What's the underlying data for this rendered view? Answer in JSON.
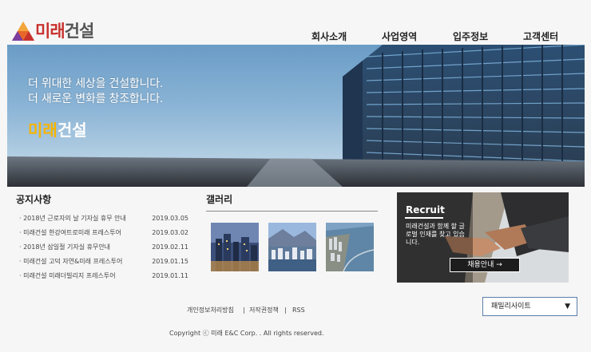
{
  "header": {
    "logo_text_1": "미래",
    "logo_text_2": "건설",
    "nav": [
      "회사소개",
      "사업영역",
      "입주정보",
      "고객센터"
    ]
  },
  "hero": {
    "line1": "더 위대한 세상을 건설합니다.",
    "line2": "더 새로운 변화를 창조합니다.",
    "brand_1": "미래",
    "brand_2": "건설"
  },
  "notice": {
    "title": "공지사항",
    "items": [
      {
        "title": "· 2018년 근로자의 날 기자실 휴무 안내",
        "date": "2019.03.05"
      },
      {
        "title": "· 미래건설 한강여트로미래 프레스투어",
        "date": "2019.03.02"
      },
      {
        "title": "· 2018년 삼일절 기자실 휴무안내",
        "date": "2019.02.11"
      },
      {
        "title": "· 미래건설 고덕 자연&미래 프레스투어",
        "date": "2019.01.15"
      },
      {
        "title": "· 미래건설 미래더빌리지 프레스투어",
        "date": "2019.01.11"
      }
    ]
  },
  "gallery": {
    "title": "갤러리"
  },
  "recruit": {
    "title": "Recruit",
    "desc": "미래건설과 함께 할 글로벌 인재를 찾고 있습니다.",
    "button": "채용안내  →"
  },
  "family_site": {
    "value": "패밀리사이트",
    "arrow": "▼"
  },
  "footer": {
    "links": [
      "개인정보처리방침",
      "|",
      "저작권정책",
      "|",
      "RSS"
    ],
    "copyright": "Copyright ⓒ 미래 E&C Corp. . All rights reserved."
  },
  "colors": {
    "brand_red": "#c8322d",
    "brand_gold": "#f5b400",
    "hero_sky": "#8cb5d6"
  }
}
